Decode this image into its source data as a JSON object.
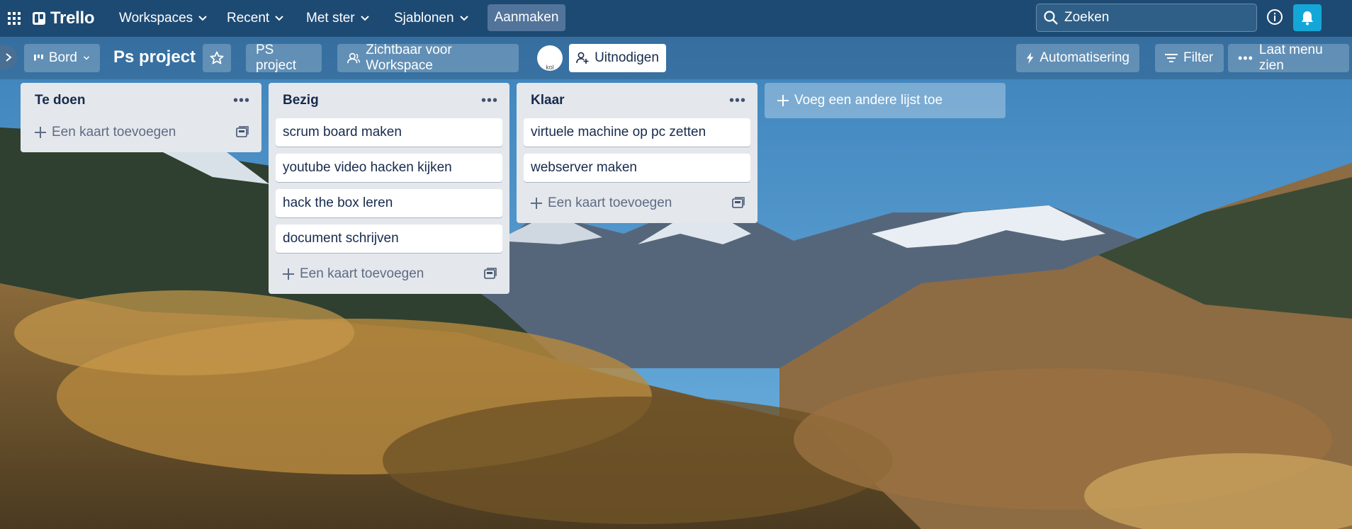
{
  "nav": {
    "brand": "Trello",
    "menus": [
      {
        "label": "Workspaces"
      },
      {
        "label": "Recent"
      },
      {
        "label": "Met ster"
      },
      {
        "label": "Sjablonen"
      }
    ],
    "create_label": "Aanmaken",
    "search_placeholder": "Zoeken",
    "icons": {
      "apps": "apps-grid-icon",
      "info": "info-icon",
      "bell": "bell-icon"
    },
    "colors": {
      "nav_bg": "#1d4a72",
      "bell_bg": "#13a7d8"
    }
  },
  "board": {
    "view_label": "Bord",
    "title": "Ps project",
    "workspace_label": "PS project",
    "visibility_label": "Zichtbaar voor Workspace",
    "avatar_alt": "kol",
    "invite_label": "Uitnodigen",
    "automation_label": "Automatisering",
    "filter_label": "Filter",
    "menu_label": "Laat menu zien"
  },
  "lists": [
    {
      "title": "Te doen",
      "cards": [],
      "add_label": "Een kaart toevoegen"
    },
    {
      "title": "Bezig",
      "cards": [
        "scrum board maken",
        "youtube video hacken kijken",
        "hack the box leren",
        "document schrijven"
      ],
      "add_label": "Een kaart toevoegen"
    },
    {
      "title": "Klaar",
      "cards": [
        "virtuele machine op pc zetten",
        "webserver maken"
      ],
      "add_label": "Een kaart toevoegen"
    }
  ],
  "add_list_label": "Voeg een andere lijst toe"
}
